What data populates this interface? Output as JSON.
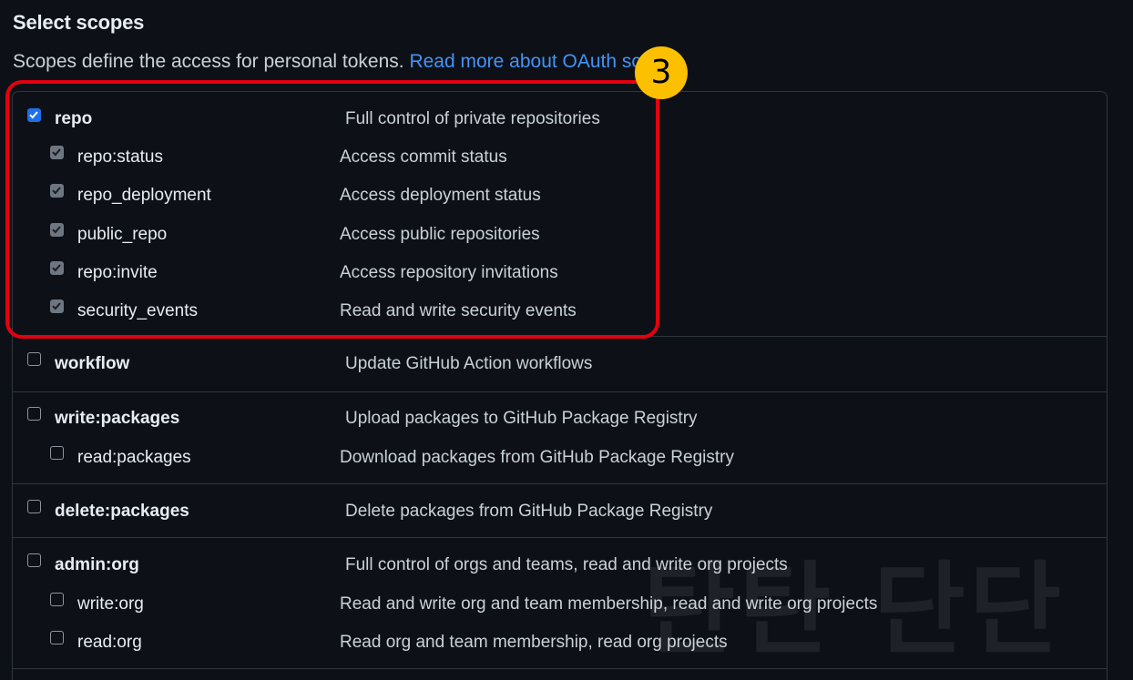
{
  "header": {
    "title": "Select scopes",
    "description": "Scopes define the access for personal tokens.",
    "link_text": "Read more about OAuth scopes."
  },
  "annotation": {
    "step_badge": "3",
    "watermark": "탄탄 단단"
  },
  "scopes": {
    "repo": {
      "name": "repo",
      "desc": "Full control of private repositories",
      "checked": true
    },
    "repo_status": {
      "name": "repo:status",
      "desc": "Access commit status",
      "checked": true
    },
    "repo_deployment": {
      "name": "repo_deployment",
      "desc": "Access deployment status",
      "checked": true
    },
    "public_repo": {
      "name": "public_repo",
      "desc": "Access public repositories",
      "checked": true
    },
    "repo_invite": {
      "name": "repo:invite",
      "desc": "Access repository invitations",
      "checked": true
    },
    "security_events": {
      "name": "security_events",
      "desc": "Read and write security events",
      "checked": true
    },
    "workflow": {
      "name": "workflow",
      "desc": "Update GitHub Action workflows",
      "checked": false
    },
    "write_packages": {
      "name": "write:packages",
      "desc": "Upload packages to GitHub Package Registry",
      "checked": false
    },
    "read_packages": {
      "name": "read:packages",
      "desc": "Download packages from GitHub Package Registry",
      "checked": false
    },
    "delete_packages": {
      "name": "delete:packages",
      "desc": "Delete packages from GitHub Package Registry",
      "checked": false
    },
    "admin_org": {
      "name": "admin:org",
      "desc": "Full control of orgs and teams, read and write org projects",
      "checked": false
    },
    "write_org": {
      "name": "write:org",
      "desc": "Read and write org and team membership, read and write org projects",
      "checked": false
    },
    "read_org": {
      "name": "read:org",
      "desc": "Read org and team membership, read org projects",
      "checked": false
    }
  },
  "colors": {
    "background": "#0d1117",
    "link": "#4493f8",
    "checkbox_checked": "#1f6feb",
    "highlight": "#e3000f",
    "badge": "#fdc000"
  }
}
